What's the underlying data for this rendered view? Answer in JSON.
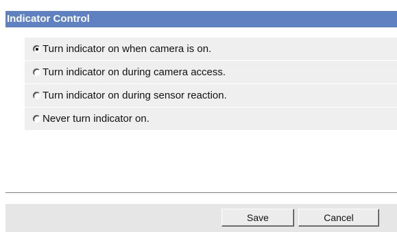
{
  "section": {
    "title": "Indicator Control"
  },
  "indicator_options": [
    {
      "label": "Turn indicator on when camera is on.",
      "selected": true
    },
    {
      "label": "Turn indicator on during camera access.",
      "selected": false
    },
    {
      "label": "Turn indicator on during sensor reaction.",
      "selected": false
    },
    {
      "label": "Never turn indicator on.",
      "selected": false
    }
  ],
  "buttons": {
    "save_label": "Save",
    "cancel_label": "Cancel"
  }
}
